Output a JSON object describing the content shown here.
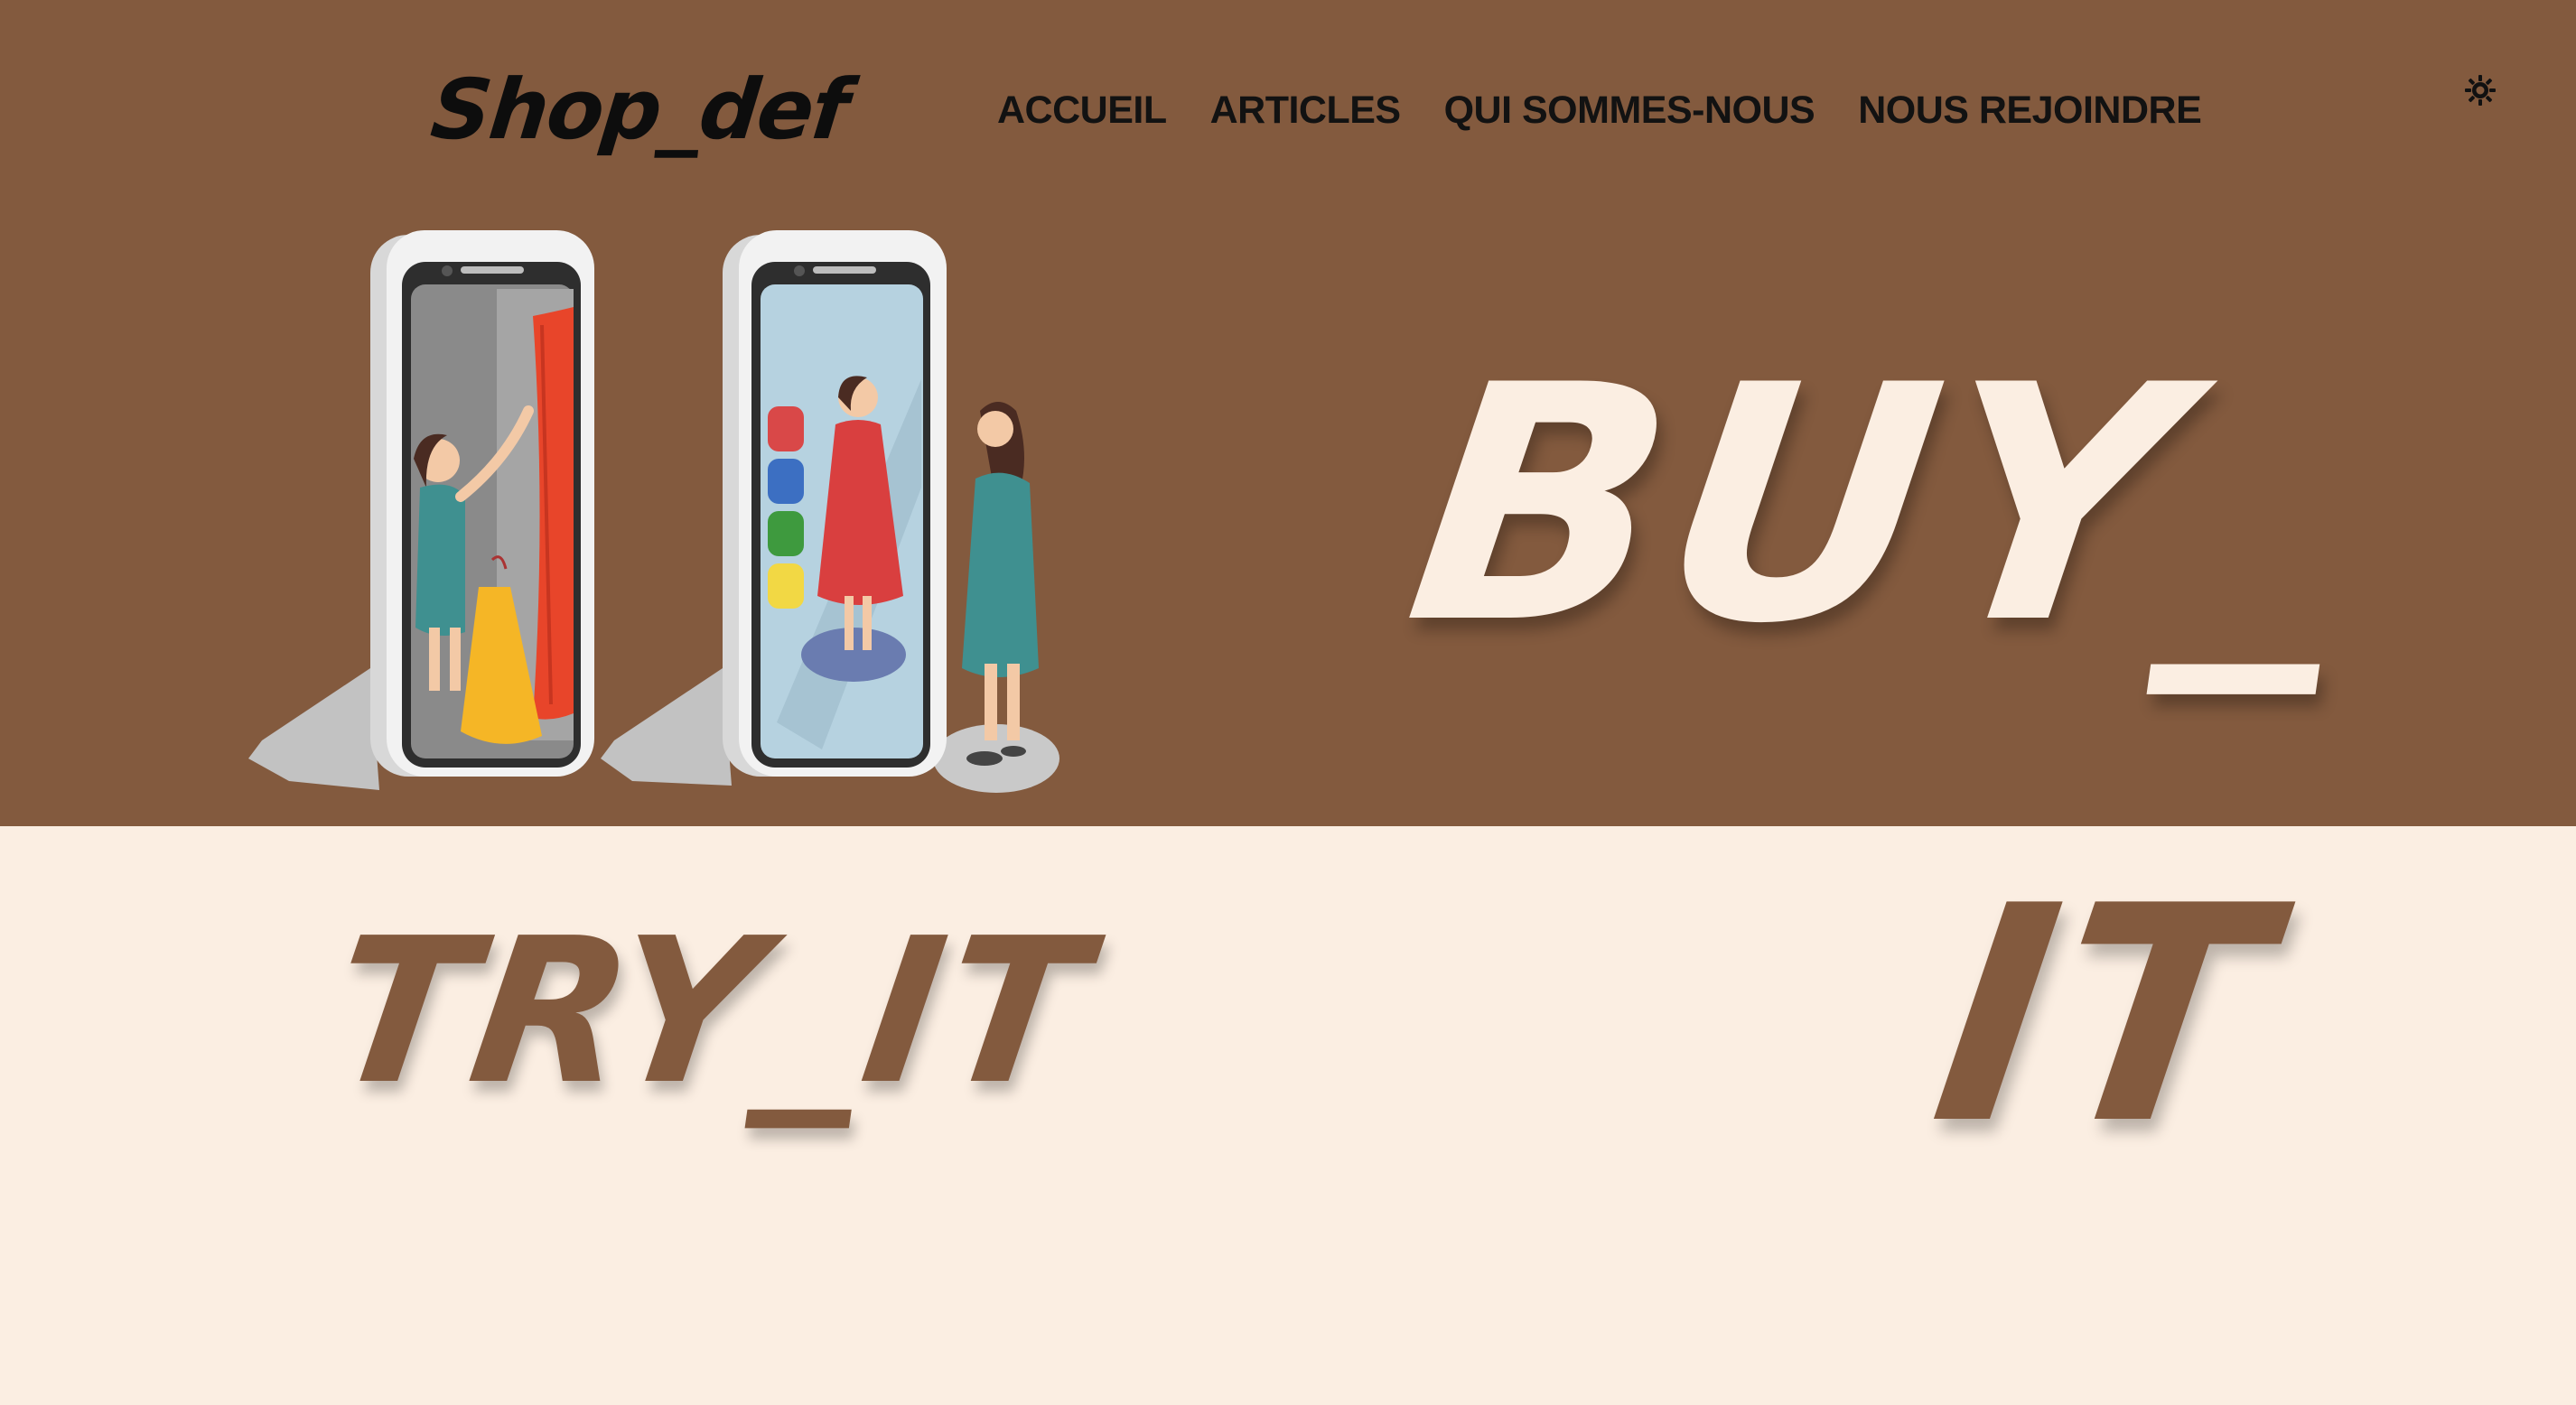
{
  "brand": {
    "logo": "Shop_def"
  },
  "nav": {
    "items": [
      {
        "label": "ACCUEIL"
      },
      {
        "label": "ARTICLES"
      },
      {
        "label": "QUI SOMMES-NOUS"
      },
      {
        "label": "NOUS REJOINDRE"
      }
    ]
  },
  "hero": {
    "headline_buy": "BUY_",
    "headline_try": "TRY_IT",
    "headline_it": "IT"
  },
  "theme": {
    "toggle_icon": "sun-icon"
  },
  "colors": {
    "hero_background": "#835A3E",
    "page_background": "#FBEEE2",
    "nav_text": "#121212"
  }
}
